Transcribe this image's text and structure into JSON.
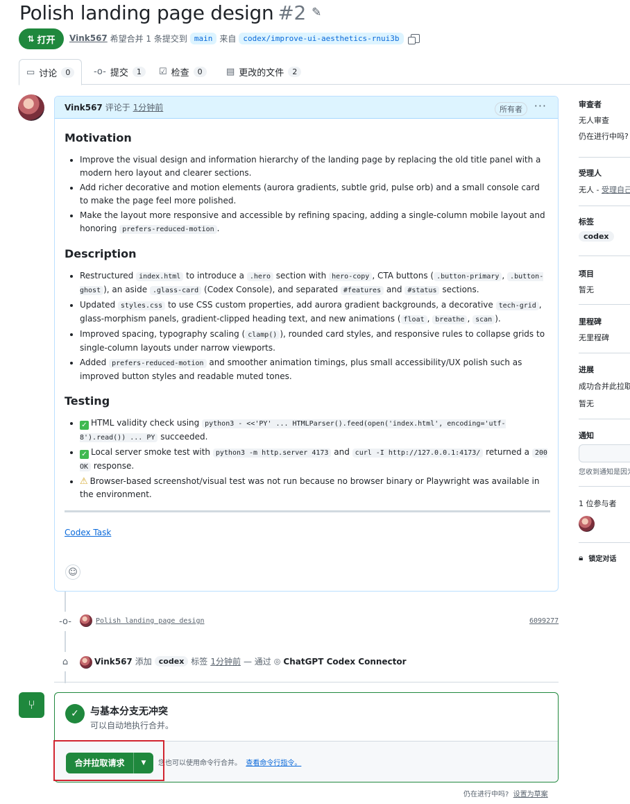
{
  "header": {
    "title": "Polish landing page design",
    "number": "#2",
    "state": "打开",
    "author": "Vink567",
    "meta_text": "希望合并 1 条提交到",
    "base_branch": "main",
    "from_text": "来自",
    "head_branch": "codex/improve-ui-aesthetics-rnui3b"
  },
  "tabs": [
    {
      "label": "讨论",
      "count": "0"
    },
    {
      "label": "提交",
      "count": "1"
    },
    {
      "label": "检查",
      "count": "0"
    },
    {
      "label": "更改的文件",
      "count": "2"
    }
  ],
  "comment": {
    "author": "Vink567",
    "action": "评论于",
    "time": "1分钟前",
    "owner_badge": "所有者",
    "motivation": {
      "heading": "Motivation",
      "b1": "Improve the visual design and information hierarchy of the landing page by replacing the old title panel with a modern hero layout and clearer sections.",
      "b2": "Add richer decorative and motion elements (aurora gradients, subtle grid, pulse orb) and a small console card to make the page feel more polished.",
      "b3": "Make the layout more responsive and accessible by refining spacing, adding a single-column mobile layout and honoring",
      "b3_code": "prefers-reduced-motion",
      "b3_end": "."
    },
    "description": {
      "heading": "Description",
      "d1": {
        "t1": "Restructured",
        "c1": "index.html",
        "t2": "to introduce a",
        "c2": ".hero",
        "t3": "section with",
        "c3": "hero-copy",
        "t4": ", CTA buttons (",
        "c4": ".button-primary",
        "t5": ",",
        "c5": ".button-ghost",
        "t6": "), an aside",
        "c6": ".glass-card",
        "t7": "(Codex Console), and separated",
        "c7": "#features",
        "t8": "and",
        "c8": "#status",
        "t9": "sections."
      },
      "d2": {
        "t1": "Updated",
        "c1": "styles.css",
        "t2": "to use CSS custom properties, add aurora gradient backgrounds, a decorative",
        "c2": "tech-grid",
        "t3": ", glass-morphism panels, gradient-clipped heading text, and new animations (",
        "c3": "float",
        "t4": ",",
        "c4": "breathe",
        "t5": ",",
        "c5": "scan",
        "t6": ")."
      },
      "d3": {
        "t1": "Improved spacing, typography scaling (",
        "c1": "clamp()",
        "t2": "), rounded card styles, and responsive rules to collapse grids to single-column layouts under narrow viewports."
      },
      "d4": {
        "t1": "Added",
        "c1": "prefers-reduced-motion",
        "t2": "and smoother animation timings, plus small accessibility/UX polish such as improved button styles and readable muted tones."
      }
    },
    "testing": {
      "heading": "Testing",
      "t1": {
        "text": "HTML validity check using",
        "code": "python3 - <<'PY' ... HTMLParser().feed(open('index.html', encoding='utf-8').read()) ... PY",
        "end": "succeeded."
      },
      "t2": {
        "text": "Local server smoke test with",
        "c1": "python3 -m http.server 4173",
        "mid": "and",
        "c2": "curl -I http://127.0.0.1:4173/",
        "mid2": "returned a",
        "c3": "200 OK",
        "end": "response."
      },
      "t3": {
        "text": "Browser-based screenshot/visual test was not run because no browser binary or Playwright was available in the environment."
      }
    },
    "link": "Codex Task"
  },
  "timeline": {
    "commit_message": "Polish landing page design",
    "commit_sha": "6099277",
    "label_event": {
      "user": "Vink567",
      "added": "添加",
      "label": "codex",
      "label_word": "标签",
      "time": "1分钟前",
      "via": "— 通过",
      "app": "ChatGPT Codex Connector"
    }
  },
  "merge": {
    "title": "与基本分支无冲突",
    "subtitle": "可以自动地执行合并。",
    "button": "合并拉取请求",
    "cli_text": "您也可以使用命令行合并。",
    "cli_link": "查看命令行指令。",
    "draft_q": "仍在进行中吗?",
    "draft_link": "设置为草案"
  },
  "sidebar": {
    "reviewers": {
      "h": "审查者",
      "v": "无人审查",
      "v2": "仍在进行中吗?"
    },
    "assignees": {
      "h": "受理人",
      "v": "无人 - ",
      "v_link": "受理自己"
    },
    "labels": {
      "h": "标签",
      "label": "codex"
    },
    "projects": {
      "h": "项目",
      "v": "暂无"
    },
    "milestone": {
      "h": "里程碑",
      "v": "无里程碑"
    },
    "development": {
      "h": "进展",
      "v": "成功合并此拉取请求",
      "v2": "暂无"
    },
    "notifications": {
      "h": "通知",
      "v": "您收到通知是因为"
    },
    "participants": {
      "h": "1 位参与者"
    },
    "lock": "锁定对话"
  },
  "colors": {
    "green": "#1f883d",
    "blue": "#0969da",
    "highlight": "#d1242f"
  }
}
